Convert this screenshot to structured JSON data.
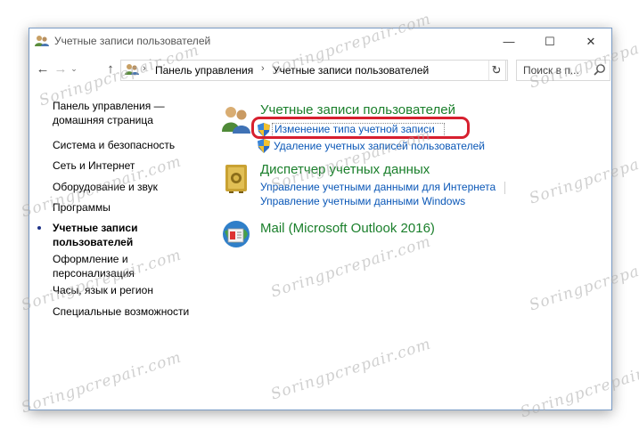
{
  "window": {
    "title": "Учетные записи пользователей",
    "minimize_icon": "—",
    "maximize_icon": "☐",
    "close_icon": "✕"
  },
  "nav": {
    "back_icon": "←",
    "forward_icon": "→",
    "recent_icon": "⌄",
    "up_icon": "↑",
    "address": {
      "crumbs": [
        "Панель управления",
        "Учетные записи пользователей"
      ],
      "separator": "›"
    },
    "dropdown_icon": "⌄",
    "refresh_icon": "↻",
    "search_placeholder": "Поиск в п..."
  },
  "sidebar": {
    "items": [
      {
        "label": "Панель управления —\nдомашняя страница",
        "line1": "Панель управления —",
        "line2": "домашняя страница"
      },
      {
        "label": "Система и безопасность"
      },
      {
        "label": "Сеть и Интернет"
      },
      {
        "label": "Оборудование и звук"
      },
      {
        "label": "Программы"
      },
      {
        "label": "Учетные записи пользователей",
        "line1": "Учетные записи",
        "line2": "пользователей",
        "current": true
      },
      {
        "label": "Оформление и персонализация",
        "line1": "Оформление и",
        "line2": "персонализация"
      },
      {
        "label": "Часы, язык и регион"
      },
      {
        "label": "Специальные возможности"
      }
    ]
  },
  "main": {
    "categories": [
      {
        "title": "Учетные записи пользователей",
        "icon": "users-icon",
        "links": [
          "Изменение типа учетной записи",
          "Удаление учетных записей пользователей"
        ]
      },
      {
        "title": "Диспетчер учетных данных",
        "icon": "credential-vault-icon",
        "links": [
          "Управление учетными данными для Интернета",
          "Управление учетными данными Windows"
        ]
      },
      {
        "title": "Mail (Microsoft Outlook 2016)",
        "icon": "mail-icon",
        "links": []
      }
    ]
  },
  "watermark": "Soringpcrepair.com",
  "colors": {
    "category_title": "#1a7f2b",
    "link": "#0a57b7",
    "highlight": "#d7202f",
    "window_border": "#7a9cc6"
  }
}
